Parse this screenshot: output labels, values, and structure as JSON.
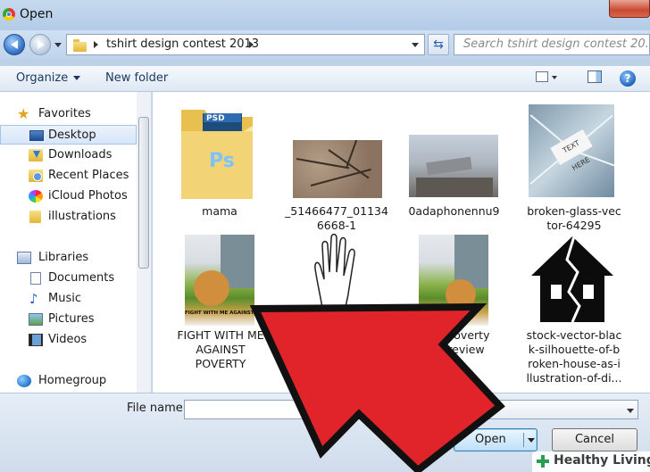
{
  "window": {
    "title": "Open",
    "close_icon": "close-icon"
  },
  "navigation": {
    "breadcrumb": [
      "tshirt design contest 2013"
    ],
    "search_placeholder": "Search tshirt design contest 20..."
  },
  "toolbar": {
    "organize_label": "Organize",
    "new_folder_label": "New folder"
  },
  "nav_pane": {
    "favorites": {
      "label": "Favorites",
      "items": [
        {
          "label": "Desktop",
          "icon": "desktop-icon",
          "selected": true
        },
        {
          "label": "Downloads",
          "icon": "downloads-folder-icon"
        },
        {
          "label": "Recent Places",
          "icon": "recent-places-icon"
        },
        {
          "label": "iCloud Photos",
          "icon": "icloud-photos-icon"
        },
        {
          "label": "illustrations",
          "icon": "folder-icon"
        }
      ]
    },
    "libraries": {
      "label": "Libraries",
      "items": [
        {
          "label": "Documents",
          "icon": "documents-icon"
        },
        {
          "label": "Music",
          "icon": "music-icon"
        },
        {
          "label": "Pictures",
          "icon": "pictures-icon"
        },
        {
          "label": "Videos",
          "icon": "videos-icon"
        }
      ]
    },
    "homegroup": {
      "label": "Homegroup"
    }
  },
  "files": [
    {
      "lines": [
        "mama"
      ],
      "kind": "folder"
    },
    {
      "lines": [
        "_51466477_01134",
        "6668-1"
      ],
      "kind": "image"
    },
    {
      "lines": [
        "0adaphonennu9"
      ],
      "kind": "image"
    },
    {
      "lines": [
        "broken-glass-vec",
        "tor-64295"
      ],
      "kind": "image",
      "thumb_text": "TEXT HERE"
    },
    {
      "lines": [
        "FIGHT WITH ME",
        "AGAINST",
        "POVERTY"
      ],
      "kind": "image",
      "thumb_text": "FIGHT WITH ME AGAINST POVERTY"
    },
    {
      "lines": [
        ""
      ],
      "kind": "image"
    },
    {
      "lines": [
        "ntpoverty",
        "preview"
      ],
      "kind": "image"
    },
    {
      "lines": [
        "stock-vector-blac",
        "k-silhouette-of-b",
        "roken-house-as-i",
        "llustration-of-di..."
      ],
      "kind": "image"
    }
  ],
  "folder_badge": "PSD",
  "folder_badge_ps": "Ps",
  "bottom": {
    "file_name_label": "File name:",
    "file_name_value": "",
    "open_label": "Open",
    "cancel_label": "Cancel"
  },
  "watermark": "Healthy Living",
  "colors": {
    "arrow": "#e0242a",
    "arrow_outline": "#111111",
    "accent": "#3c7fb1"
  }
}
